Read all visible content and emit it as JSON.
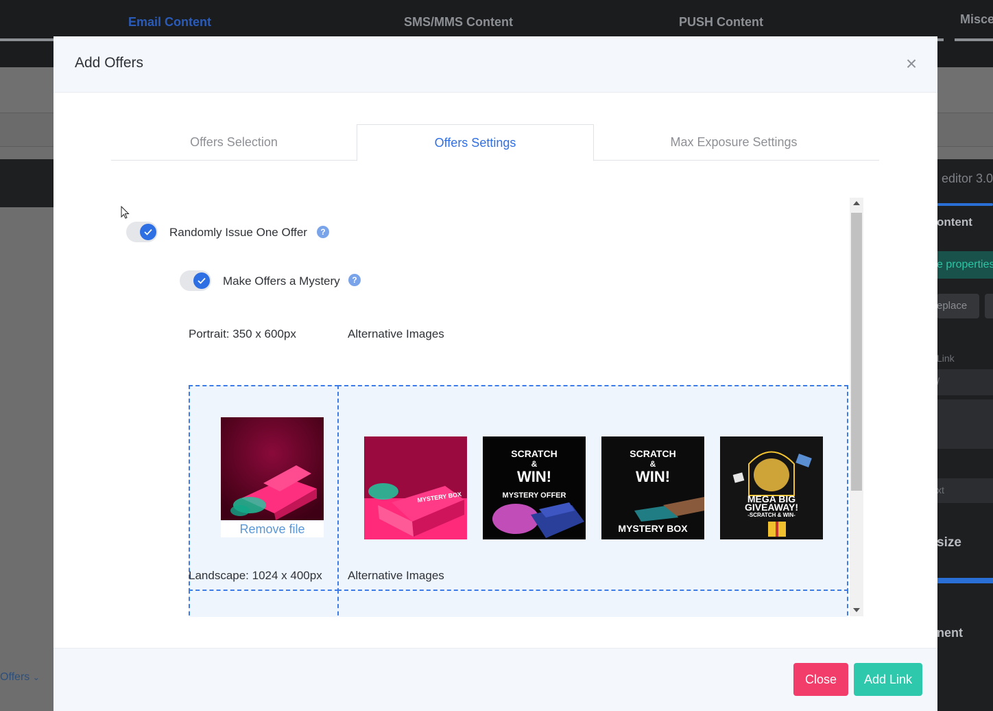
{
  "background": {
    "tabs": [
      {
        "label": "Email Content",
        "active": true
      },
      {
        "label": "SMS/MMS Content",
        "active": false
      },
      {
        "label": "PUSH Content",
        "active": false
      },
      {
        "label": "Misce",
        "active": false
      }
    ],
    "right_panel": {
      "editor": "editor 3.0",
      "content": "ontent",
      "properties": "e properties",
      "replace": "eplace",
      "link": "Link",
      "slash": "/",
      "ext": "xt",
      "size": "size",
      "ment": "nent"
    },
    "offers_dropdown": "Offers"
  },
  "modal": {
    "title": "Add Offers",
    "close_icon": "×",
    "tabs": [
      {
        "label": "Offers Selection",
        "active": false
      },
      {
        "label": "Offers Settings",
        "active": true
      },
      {
        "label": "Max Exposure Settings",
        "active": false
      }
    ],
    "options": {
      "randomly_issue": {
        "label": "Randomly Issue One Offer",
        "enabled": true,
        "help": "?"
      },
      "mystery": {
        "label": "Make Offers a Mystery",
        "enabled": true,
        "help": "?"
      }
    },
    "portrait": {
      "label": "Portrait: 350 x 600px",
      "alt_label": "Alternative Images",
      "remove_label": "Remove file",
      "alternatives": [
        {
          "name": "mystery-box-pink",
          "caption": "MYSTERY BOX"
        },
        {
          "name": "scratch-win-mystery-offer",
          "line1": "SCRATCH",
          "line2": "&",
          "line3": "WIN!",
          "line4": "MYSTERY OFFER"
        },
        {
          "name": "scratch-win-mystery-box",
          "line1": "SCRATCH",
          "line2": "&",
          "line3": "WIN!",
          "line4": "MYSTERY BOX"
        },
        {
          "name": "mega-big-giveaway",
          "line1": "MEGA BIG",
          "line2": "GIVEAWAY!",
          "line3": "-SCRATCH & WIN-"
        }
      ]
    },
    "landscape": {
      "label": "Landscape: 1024 x 400px",
      "alt_label": "Alternative Images"
    },
    "footer": {
      "close_label": "Close",
      "add_link_label": "Add Link"
    }
  },
  "colors": {
    "primary": "#2f6fe4",
    "danger": "#f23d6b",
    "success": "#2ec9ad",
    "dropzone_border": "#3d7be6"
  }
}
